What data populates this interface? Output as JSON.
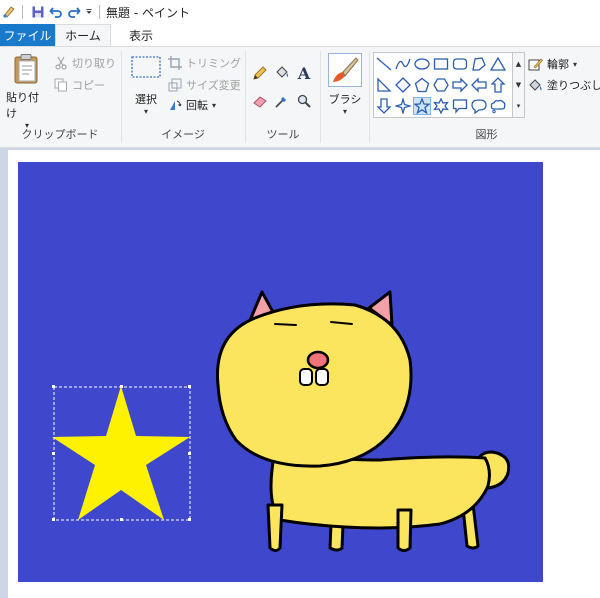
{
  "titlebar": {
    "title": "無題 - ペイント",
    "quick_access": [
      "app-icon",
      "save-icon",
      "undo-icon",
      "redo-icon",
      "customize-dropdown-icon"
    ]
  },
  "tabs": [
    {
      "label": "ファイル"
    },
    {
      "label": "ホーム"
    },
    {
      "label": "表示"
    }
  ],
  "ribbon": {
    "clipboard": {
      "label": "クリップボード",
      "paste": "貼り付け",
      "cut": "切り取り",
      "copy": "コピー"
    },
    "image": {
      "label": "イメージ",
      "select": "選択",
      "crop": "トリミング",
      "resize": "サイズ変更",
      "rotate": "回転"
    },
    "tools": {
      "label": "ツール"
    },
    "brushes": {
      "label": "ブラシ"
    },
    "shapes": {
      "label": "図形",
      "outline": "輪郭",
      "fill": "塗りつぶし"
    }
  },
  "colors": {
    "accent": "#1979ca",
    "canvas_bg": "#3f48cc",
    "star": "#fff200",
    "cat": "#fbe55e",
    "ear": "#f3a1a8",
    "nose": "#f0747c"
  }
}
